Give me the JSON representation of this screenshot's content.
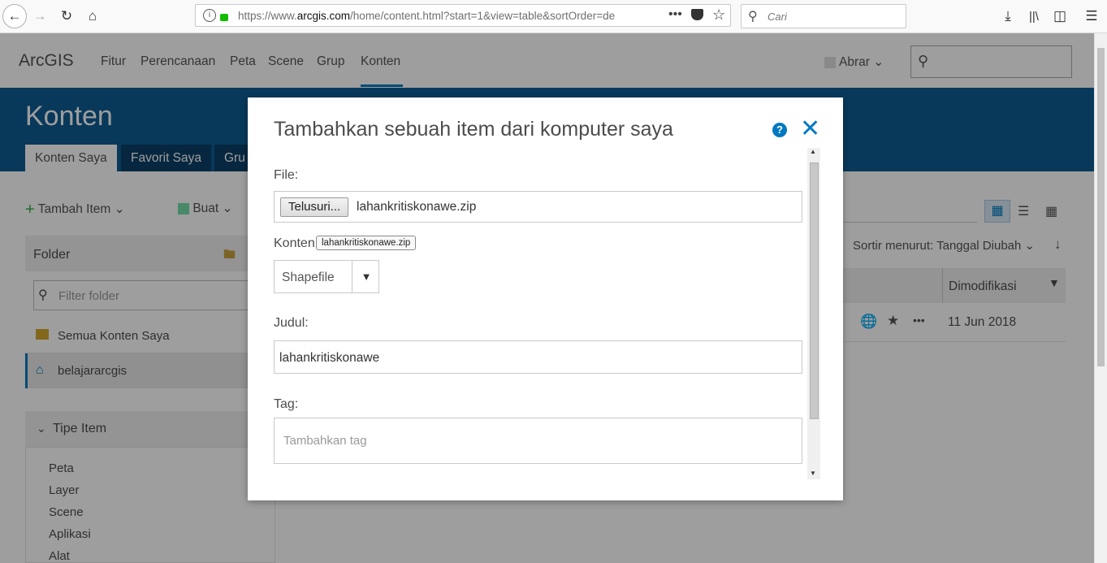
{
  "browser": {
    "url_prefix": "https://www.",
    "url_host": "arcgis.com",
    "url_rest": "/home/content.html?start=1&view=table&sortOrder=de",
    "search_placeholder": "Cari"
  },
  "header": {
    "logo": "ArcGIS",
    "nav": [
      "Fitur",
      "Perencanaan",
      "Peta",
      "Scene",
      "Grup",
      "Konten"
    ],
    "user": "Abrar"
  },
  "banner": {
    "title": "Konten",
    "tabs": [
      "Konten Saya",
      "Favorit Saya",
      "Gru"
    ]
  },
  "toolbar": {
    "add_item": "Tambah Item",
    "create": "Buat",
    "sort": "Sortir menurut: Tanggal Diubah"
  },
  "folder_panel": {
    "title": "Folder",
    "filter_placeholder": "Filter folder",
    "items": [
      "Semua Konten Saya",
      "belajararcgis"
    ]
  },
  "type_panel": {
    "title": "Tipe Item",
    "items": [
      "Peta",
      "Layer",
      "Scene",
      "Aplikasi",
      "Alat"
    ]
  },
  "table": {
    "col_modified": "Dimodifikasi",
    "row_date": "11 Jun 2018"
  },
  "modal": {
    "title": "Tambahkan sebuah item dari komputer saya",
    "file_label": "File:",
    "browse_button": "Telusuri...",
    "file_name": "lahankritiskonawe.zip",
    "content_label": "Konten",
    "tooltip": "lahankritiskonawe.zip",
    "content_type": "Shapefile",
    "title_label": "Judul:",
    "title_value": "lahankritiskonawe",
    "tag_label": "Tag:",
    "tag_placeholder": "Tambahkan tag"
  },
  "colors": {
    "accent": "#0079c1",
    "banner": "#0e5d94"
  }
}
